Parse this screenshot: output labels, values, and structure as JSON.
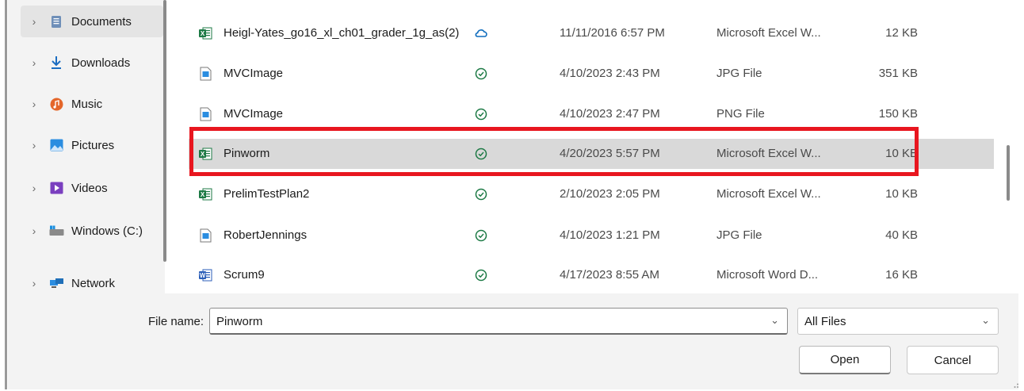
{
  "nav": {
    "items": [
      {
        "label": "Documents",
        "icon": "documents-icon"
      },
      {
        "label": "Downloads",
        "icon": "downloads-icon"
      },
      {
        "label": "Music",
        "icon": "music-icon"
      },
      {
        "label": "Pictures",
        "icon": "pictures-icon"
      },
      {
        "label": "Videos",
        "icon": "videos-icon"
      },
      {
        "label": "Windows (C:)",
        "icon": "drive-icon"
      },
      {
        "label": "Network",
        "icon": "network-icon"
      }
    ],
    "selected": "Documents"
  },
  "files": [
    {
      "name": "Heigl-Yates_go16_xl_ch01_grader_1g_as(2)",
      "status": "cloud",
      "date": "11/11/2016 6:57 PM",
      "type": "Microsoft Excel W...",
      "size": "12 KB",
      "icon": "excel-file-icon"
    },
    {
      "name": "MVCImage",
      "status": "synced",
      "date": "4/10/2023 2:43 PM",
      "type": "JPG File",
      "size": "351 KB",
      "icon": "image-file-icon"
    },
    {
      "name": "MVCImage",
      "status": "synced",
      "date": "4/10/2023 2:47 PM",
      "type": "PNG File",
      "size": "150 KB",
      "icon": "image-file-icon"
    },
    {
      "name": "Pinworm",
      "status": "synced",
      "date": "4/20/2023 5:57 PM",
      "type": "Microsoft Excel W...",
      "size": "10 KB",
      "icon": "excel-file-icon",
      "selected": true
    },
    {
      "name": "PrelimTestPlan2",
      "status": "synced",
      "date": "2/10/2023 2:05 PM",
      "type": "Microsoft Excel W...",
      "size": "10 KB",
      "icon": "excel-file-icon"
    },
    {
      "name": "RobertJennings",
      "status": "synced",
      "date": "4/10/2023 1:21 PM",
      "type": "JPG File",
      "size": "40 KB",
      "icon": "image-file-icon"
    },
    {
      "name": "Scrum9",
      "status": "synced",
      "date": "4/17/2023 8:55 AM",
      "type": "Microsoft Word D...",
      "size": "16 KB",
      "icon": "word-file-icon"
    }
  ],
  "footer": {
    "file_name_label": "File name:",
    "file_name_value": "Pinworm",
    "file_type_value": "All Files",
    "open_label": "Open",
    "cancel_label": "Cancel"
  },
  "colors": {
    "highlight": "#e8161f",
    "excel": "#1d7a45",
    "word": "#2b5eb8",
    "synced": "#1d7a45",
    "cloud": "#0f6cbd"
  }
}
